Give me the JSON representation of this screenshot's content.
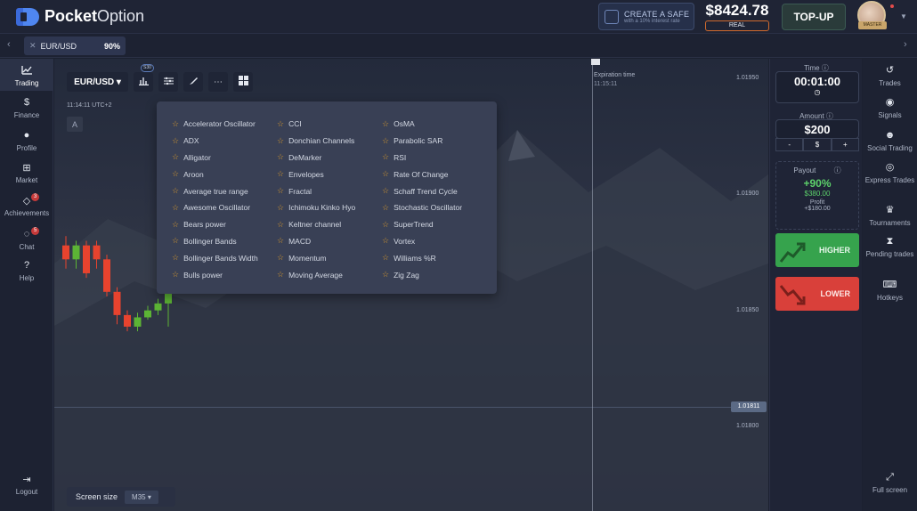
{
  "header": {
    "logo_bold": "Pocket",
    "logo_light": "Option",
    "safe_title": "CREATE A SAFE",
    "safe_sub": "with a 10% interest rate",
    "balance": "$8424.78",
    "balance_tag": "REAL",
    "topup": "TOP-UP",
    "avatar_tag": "MASTER"
  },
  "tabbar": {
    "asset": "EUR/USD",
    "percent": "90%"
  },
  "leftnav": [
    {
      "label": "Trading",
      "icon": "chart-line-icon"
    },
    {
      "label": "Finance",
      "icon": "dollar-icon"
    },
    {
      "label": "Profile",
      "icon": "user-icon"
    },
    {
      "label": "Market",
      "icon": "cart-icon"
    },
    {
      "label": "Achievements",
      "icon": "diamond-icon",
      "badge": "3"
    },
    {
      "label": "Chat",
      "icon": "chat-icon",
      "badge": "5"
    },
    {
      "label": "Help",
      "icon": "help-icon"
    },
    {
      "label": "Logout",
      "icon": "logout-icon"
    }
  ],
  "chart": {
    "pair": "EUR/USD",
    "tool_badge": "S30",
    "time": "11:14:11 UTC+2",
    "a_label": "A",
    "expiration_label": "Expiration time",
    "expiration_time": "11:15:11",
    "prices": [
      "1.01950",
      "1.01900",
      "1.01850",
      "1.01800"
    ],
    "current_price": "1.01811",
    "screen_size_label": "Screen size",
    "screen_size_value": "M35"
  },
  "indicators": {
    "col1": [
      "Accelerator Oscillator",
      "ADX",
      "Alligator",
      "Aroon",
      "Average true range",
      "Awesome Oscillator",
      "Bears power",
      "Bollinger Bands",
      "Bollinger Bands Width",
      "Bulls power"
    ],
    "col2": [
      "CCI",
      "Donchian Channels",
      "DeMarker",
      "Envelopes",
      "Fractal",
      "Ichimoku Kinko Hyo",
      "Keltner channel",
      "MACD",
      "Momentum",
      "Moving Average"
    ],
    "col3": [
      "OsMA",
      "Parabolic SAR",
      "RSI",
      "Rate Of Change",
      "Schaff Trend Cycle",
      "Stochastic Oscillator",
      "SuperTrend",
      "Vortex",
      "Williams %R",
      "Zig Zag"
    ]
  },
  "panel": {
    "time_label": "Time",
    "time_value": "00:01:00",
    "amount_label": "Amount",
    "amount_value": "$200",
    "minus": "-",
    "dollar": "$",
    "plus": "+",
    "payout_label": "Payout",
    "payout_value": "+90%",
    "payout_amount": "$380.00",
    "profit_label": "Profit",
    "profit_value": "+$180.00",
    "higher": "HIGHER",
    "lower": "LOWER"
  },
  "rightnav": [
    {
      "label": "Trades",
      "icon": "history-icon"
    },
    {
      "label": "Signals",
      "icon": "signals-icon"
    },
    {
      "label": "Social Trading",
      "icon": "social-icon"
    },
    {
      "label": "Express Trades",
      "icon": "express-icon"
    },
    {
      "label": "Tournaments",
      "icon": "trophy-icon"
    },
    {
      "label": "Pending trades",
      "icon": "hourglass-icon"
    },
    {
      "label": "Hotkeys",
      "icon": "keyboard-icon"
    },
    {
      "label": "Full screen",
      "icon": "fullscreen-icon"
    }
  ],
  "chart_data": {
    "type": "candlestick",
    "candles": [
      {
        "open": 1.01878,
        "close": 1.01872,
        "high": 1.01882,
        "low": 1.01868
      },
      {
        "open": 1.01872,
        "close": 1.01878,
        "high": 1.0188,
        "low": 1.01868
      },
      {
        "open": 1.01878,
        "close": 1.01866,
        "high": 1.0188,
        "low": 1.01864
      },
      {
        "open": 1.01878,
        "close": 1.01872,
        "high": 1.0188,
        "low": 1.01868
      },
      {
        "open": 1.01872,
        "close": 1.01858,
        "high": 1.01874,
        "low": 1.01856
      },
      {
        "open": 1.01858,
        "close": 1.01848,
        "high": 1.0186,
        "low": 1.01844
      },
      {
        "open": 1.01848,
        "close": 1.01843,
        "high": 1.0185,
        "low": 1.01841
      },
      {
        "open": 1.01843,
        "close": 1.01847,
        "high": 1.01849,
        "low": 1.01841
      },
      {
        "open": 1.01847,
        "close": 1.0185,
        "high": 1.01852,
        "low": 1.01846
      },
      {
        "open": 1.0185,
        "close": 1.01853,
        "high": 1.01855,
        "low": 1.01848
      },
      {
        "open": 1.01853,
        "close": 1.01862,
        "high": 1.01864,
        "low": 1.01843
      }
    ]
  },
  "colors": {
    "higher": "#36a34d",
    "lower": "#d9403a",
    "up_candle": "#5cb435",
    "down_candle": "#e8432e"
  }
}
